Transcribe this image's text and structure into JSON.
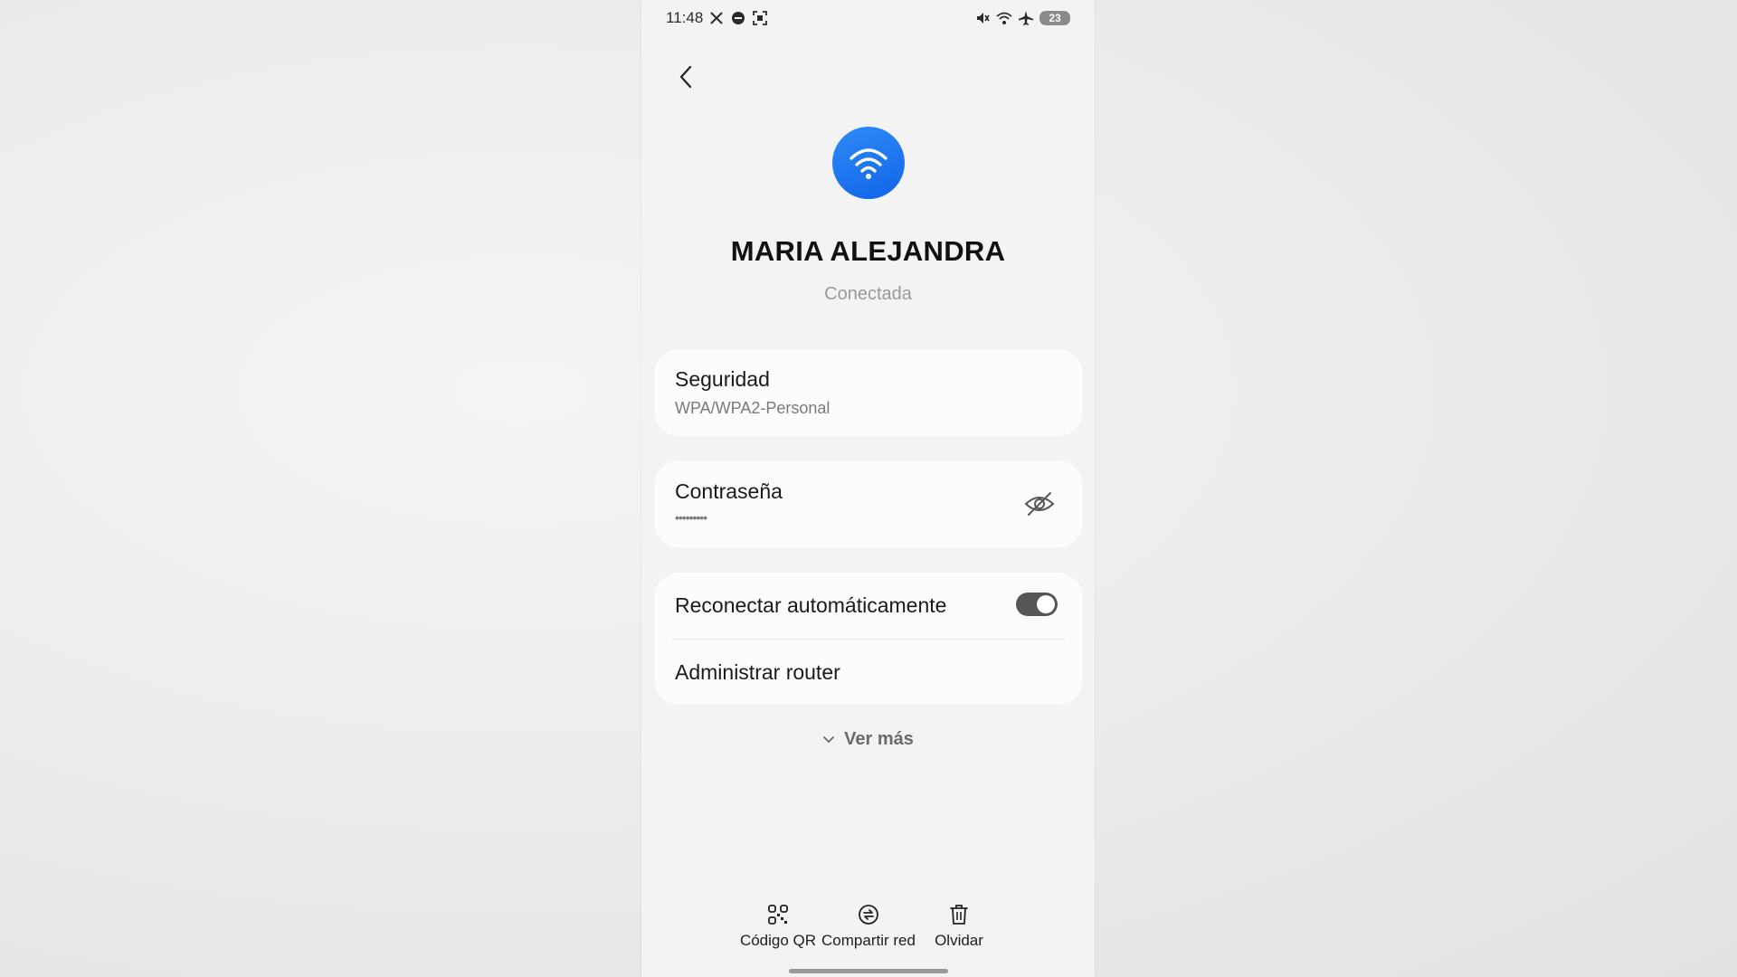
{
  "status_bar": {
    "time": "11:48",
    "battery": "23",
    "left_icons": [
      "x-icon",
      "vpn-icon",
      "screenshot-icon"
    ],
    "right_icons": [
      "mute-icon",
      "wifi-icon",
      "airplane-icon"
    ]
  },
  "network": {
    "name": "MARIA ALEJANDRA",
    "status": "Conectada",
    "icon": "wifi-icon",
    "accent_color": "#1a73f0"
  },
  "security": {
    "title": "Seguridad",
    "value": "WPA/WPA2-Personal"
  },
  "password": {
    "title": "Contraseña",
    "value": "•••••••••",
    "visibility_icon": "eye-off-icon"
  },
  "options": {
    "auto_reconnect_label": "Reconectar automáticamente",
    "auto_reconnect_enabled": true,
    "manage_router_label": "Administrar router"
  },
  "see_more": {
    "label": "Ver más"
  },
  "bottom_actions": [
    {
      "label": "Código QR",
      "icon": "qr-code-icon"
    },
    {
      "label": "Compartir red",
      "icon": "share-network-icon"
    },
    {
      "label": "Olvidar",
      "icon": "trash-icon"
    }
  ]
}
